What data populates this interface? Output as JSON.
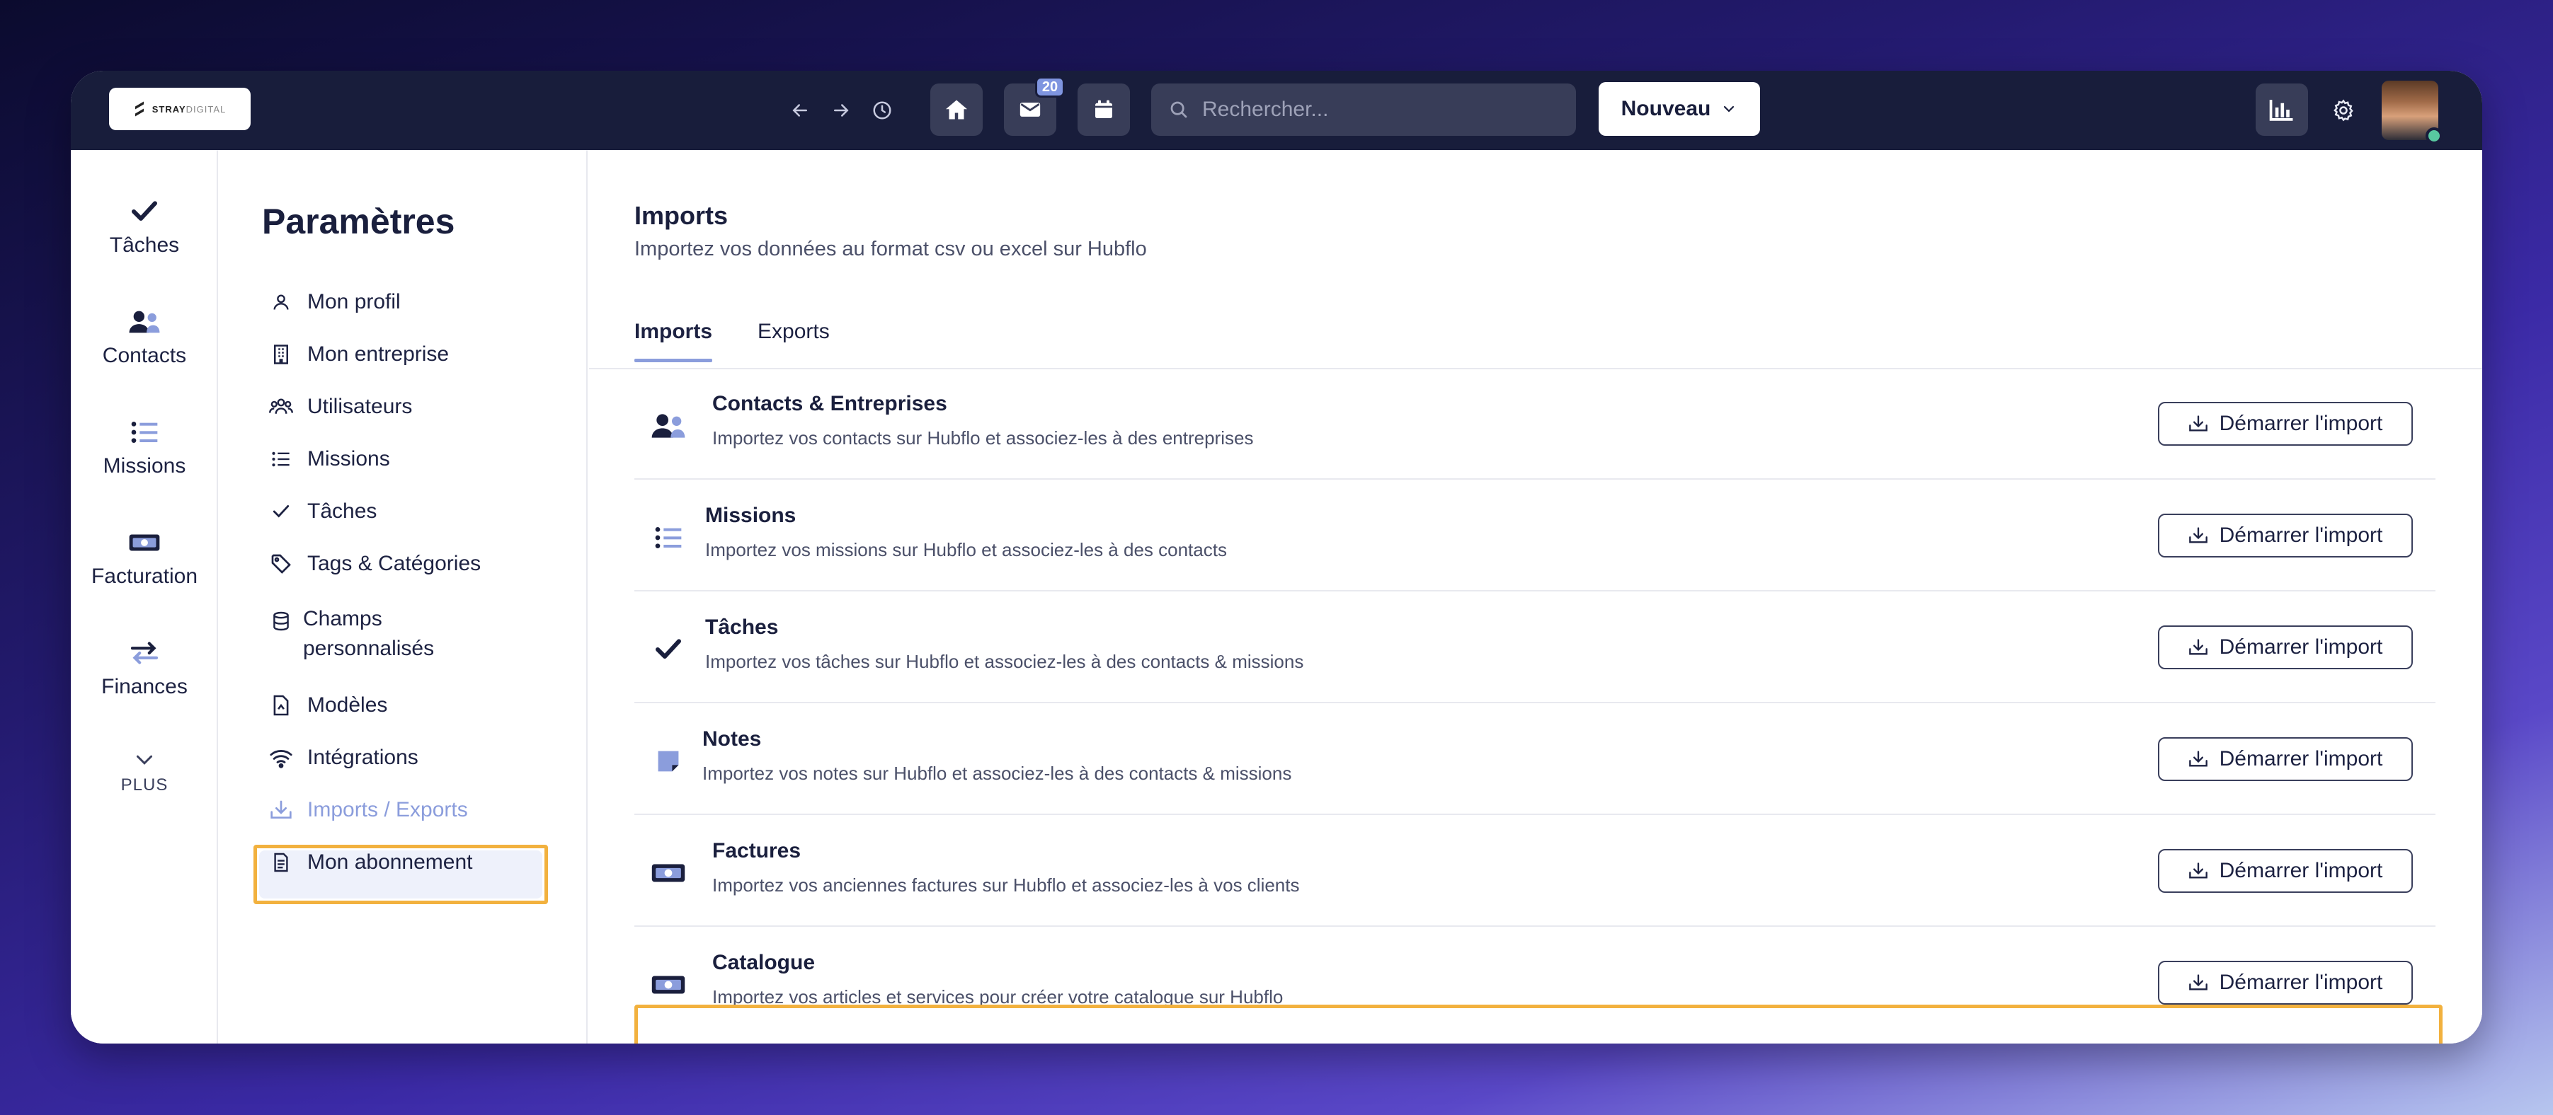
{
  "brand": {
    "name_bold": "STRAY",
    "name_light": "DIGITAL"
  },
  "topbar": {
    "mail_badge": "20",
    "search_placeholder": "Rechercher...",
    "new_label": "Nouveau"
  },
  "rail": {
    "items": [
      {
        "label": "Tâches",
        "icon": "check-icon"
      },
      {
        "label": "Contacts",
        "icon": "users-icon"
      },
      {
        "label": "Missions",
        "icon": "list-icon"
      },
      {
        "label": "Facturation",
        "icon": "banknote-icon"
      },
      {
        "label": "Finances",
        "icon": "transfer-icon"
      }
    ],
    "more_label": "PLUS"
  },
  "settings": {
    "title": "Paramètres",
    "items": [
      {
        "label": "Mon profil",
        "icon": "user-icon"
      },
      {
        "label": "Mon entreprise",
        "icon": "building-icon"
      },
      {
        "label": "Utilisateurs",
        "icon": "users-icon"
      },
      {
        "label": "Missions",
        "icon": "list-icon"
      },
      {
        "label": "Tâches",
        "icon": "check-icon"
      },
      {
        "label": "Tags & Catégories",
        "icon": "tag-icon"
      },
      {
        "label": "Champs\npersonnalisés",
        "icon": "database-icon"
      },
      {
        "label": "Modèles",
        "icon": "file-icon"
      },
      {
        "label": "Intégrations",
        "icon": "wifi-icon"
      },
      {
        "label": "Imports / Exports",
        "icon": "import-icon",
        "active": true
      },
      {
        "label": "Mon abonnement",
        "icon": "document-icon"
      }
    ]
  },
  "main": {
    "title": "Imports",
    "subtitle": "Importez vos données au format csv ou excel sur Hubflo",
    "tabs": [
      {
        "label": "Imports",
        "active": true
      },
      {
        "label": "Exports",
        "active": false
      }
    ],
    "button_label": "Démarrer l'import",
    "rows": [
      {
        "title": "Contacts & Entreprises",
        "desc": "Importez vos contacts sur Hubflo et associez-les à des entreprises",
        "icon": "users-icon"
      },
      {
        "title": "Missions",
        "desc": "Importez vos missions sur Hubflo et associez-les à des contacts",
        "icon": "list-icon"
      },
      {
        "title": "Tâches",
        "desc": "Importez vos tâches sur Hubflo et associez-les à des contacts & missions",
        "icon": "check-icon"
      },
      {
        "title": "Notes",
        "desc": "Importez vos notes sur Hubflo et associez-les à des contacts & missions",
        "icon": "note-icon"
      },
      {
        "title": "Factures",
        "desc": "Importez vos anciennes factures sur Hubflo et associez-les à vos clients",
        "icon": "banknote-icon"
      },
      {
        "title": "Catalogue",
        "desc": "Importez vos articles et services pour créer votre catalogue sur Hubflo",
        "icon": "banknote-icon"
      }
    ]
  },
  "colors": {
    "topbar": "#181d3b",
    "accent": "#8b9ddc",
    "highlight": "#f2b13e"
  }
}
